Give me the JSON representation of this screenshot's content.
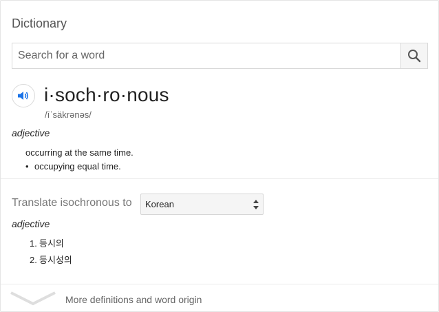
{
  "dictionary": {
    "title": "Dictionary",
    "search": {
      "placeholder": "Search for a word"
    },
    "entry": {
      "headword": "i·soch·ro·nous",
      "phonetic": "/īˈsäkrənəs/",
      "part_of_speech": "adjective",
      "definitions": [
        "occurring at the same time.",
        "occupying equal time."
      ]
    },
    "translate": {
      "label": "Translate isochronous to",
      "selected_language": "Korean",
      "part_of_speech": "adjective",
      "items": [
        {
          "num": "1.",
          "text": "등시의"
        },
        {
          "num": "2.",
          "text": "등시성의"
        }
      ]
    },
    "more_link": "More definitions and word origin"
  }
}
